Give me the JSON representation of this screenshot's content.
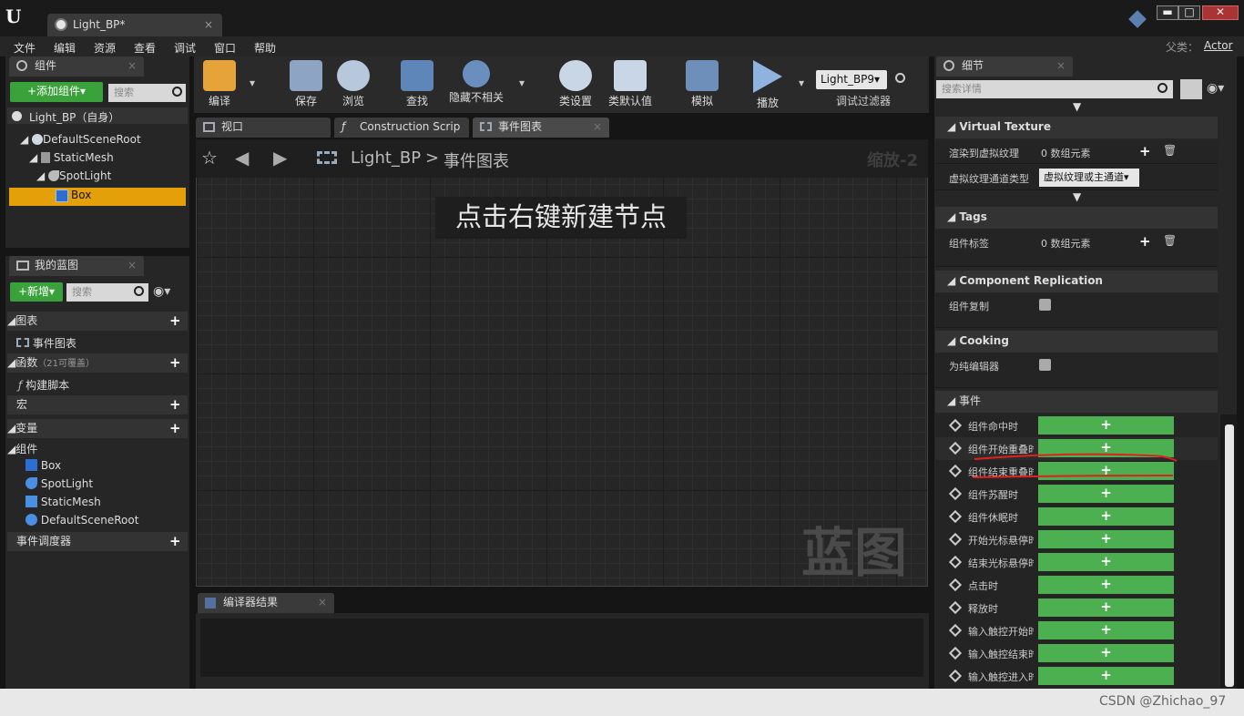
{
  "app": {
    "logo": "U"
  },
  "document_tab": {
    "title": "Light_BP*",
    "close": "×"
  },
  "window_controls": {
    "minimize": "▬",
    "maximize": "□",
    "close": "✕"
  },
  "menu": [
    "文件",
    "编辑",
    "资源",
    "查看",
    "调试",
    "窗口",
    "帮助"
  ],
  "parent_class": {
    "label": "父类：",
    "value": "Actor"
  },
  "components_panel": {
    "tab": "组件",
    "add_button": "+添加组件▾",
    "search_placeholder": "搜索",
    "self_item": "Light_BP（自身）",
    "tree": [
      "DefaultSceneRoot",
      "StaticMesh",
      "SpotLight",
      "Box"
    ],
    "selected": "Box"
  },
  "my_blueprint": {
    "tab": "我的蓝图",
    "new_button": "+新增▾",
    "search_placeholder": "搜索",
    "sections": {
      "graphs": "图表",
      "event_graph": "事件图表",
      "functions": "函数",
      "functions_note": "（21可覆盖）",
      "construction_script": "构建脚本",
      "macros": "宏",
      "variables": "变量",
      "components": "组件",
      "component_items": [
        "Box",
        "SpotLight",
        "StaticMesh",
        "DefaultSceneRoot"
      ],
      "event_dispatchers": "事件调度器"
    }
  },
  "toolbar": {
    "compile": "编译",
    "save": "保存",
    "browse": "浏览",
    "find": "查找",
    "hide_unrelated": "隐藏不相关",
    "class_settings": "类设置",
    "class_defaults": "类默认值",
    "simulate": "模拟",
    "play": "播放",
    "debug_dropdown": "Light_BP9▾",
    "debug_filter": "调试过滤器"
  },
  "editor_tabs": [
    {
      "label": "视口"
    },
    {
      "label": "Construction Scrip"
    },
    {
      "label": "事件图表"
    }
  ],
  "graph": {
    "breadcrumb_root": "Light_BP",
    "breadcrumb_sep": ">",
    "breadcrumb_current": "事件图表",
    "zoom": "缩放-2",
    "hint": "点击右键新建节点",
    "watermark": "蓝图"
  },
  "compiler_results": {
    "tab": "编译器结果"
  },
  "details": {
    "tab": "细节",
    "search_placeholder": "搜索详情",
    "virtual_texture": {
      "title": "Virtual Texture",
      "render_label": "渲染到虚拟纹理",
      "render_value": "0 数组元素",
      "type_label": "虚拟纹理通道类型",
      "type_value": "虚拟纹理或主通道▾"
    },
    "tags": {
      "title": "Tags",
      "label": "组件标签",
      "value": "0 数组元素"
    },
    "replication": {
      "title": "Component Replication",
      "label": "组件复制"
    },
    "cooking": {
      "title": "Cooking",
      "label": "为纯编辑器"
    },
    "events": {
      "title": "事件",
      "items": [
        "组件命中时",
        "组件开始重叠时",
        "组件结束重叠时",
        "组件苏醒时",
        "组件休眠时",
        "开始光标悬停时",
        "结束光标悬停时",
        "点击时",
        "释放时",
        "输入触控开始时",
        "输入触控结束时",
        "输入触控进入时"
      ]
    }
  },
  "watermark": "CSDN @Zhichao_97"
}
